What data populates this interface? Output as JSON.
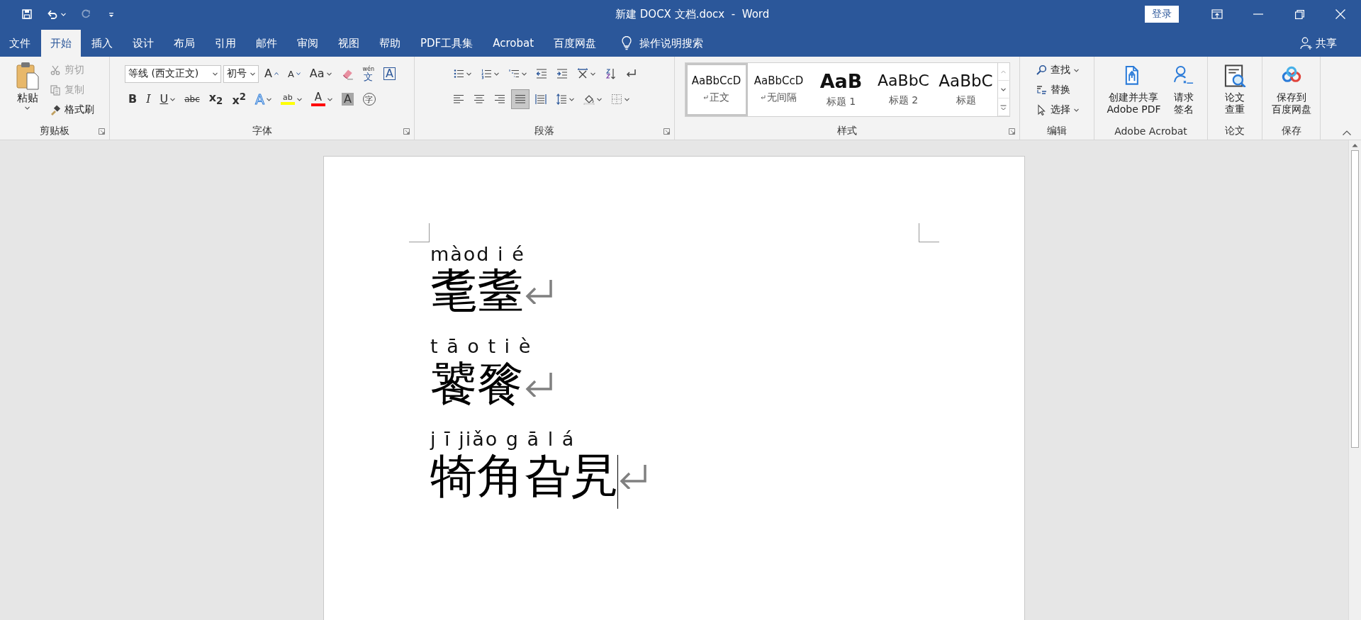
{
  "window": {
    "title": "新建 DOCX 文档.docx  -  Word",
    "sign_in": "登录"
  },
  "quick_access": [
    {
      "kind": "save",
      "disabled": false
    },
    {
      "kind": "undo",
      "disabled": false
    },
    {
      "kind": "redo",
      "disabled": true
    },
    {
      "kind": "customize",
      "disabled": false
    }
  ],
  "tabs": [
    {
      "label": "文件",
      "selected": false
    },
    {
      "label": "开始",
      "selected": true
    },
    {
      "label": "插入",
      "selected": false
    },
    {
      "label": "设计",
      "selected": false
    },
    {
      "label": "布局",
      "selected": false
    },
    {
      "label": "引用",
      "selected": false
    },
    {
      "label": "邮件",
      "selected": false
    },
    {
      "label": "审阅",
      "selected": false
    },
    {
      "label": "视图",
      "selected": false
    },
    {
      "label": "帮助",
      "selected": false
    },
    {
      "label": "PDF工具集",
      "selected": false
    },
    {
      "label": "Acrobat",
      "selected": false
    },
    {
      "label": "百度网盘",
      "selected": false
    }
  ],
  "tell_me": "操作说明搜索",
  "share": "共享",
  "ribbon": {
    "clipboard": {
      "group": "剪贴板",
      "paste": "粘贴",
      "tools": [
        {
          "kind": "cut",
          "label": "剪切",
          "disabled": true
        },
        {
          "kind": "copy",
          "label": "复制",
          "disabled": true
        },
        {
          "kind": "format-painter",
          "label": "格式刷",
          "disabled": false
        }
      ]
    },
    "font": {
      "group": "字体",
      "font_name": "等线 (西文正文)",
      "font_size": "初号",
      "row1": [
        {
          "kind": "grow-font",
          "glyph": "A",
          "menu": false
        },
        {
          "kind": "shrink-font",
          "glyph": "A",
          "menu": false
        },
        {
          "kind": "change-case",
          "glyph": "Aa",
          "menu": true
        },
        {
          "kind": "clear-formatting",
          "menu": false
        },
        {
          "kind": "phonetic-guide",
          "glyph": "文",
          "ruby": "wén",
          "menu": false
        },
        {
          "kind": "character-border",
          "glyph": "A",
          "menu": false
        }
      ],
      "row2": [
        {
          "kind": "bold",
          "glyph": "B",
          "menu": false
        },
        {
          "kind": "italic",
          "glyph": "I",
          "menu": false
        },
        {
          "kind": "underline",
          "glyph": "U",
          "menu": true
        },
        {
          "kind": "strikethrough",
          "glyph": "abc",
          "menu": false
        },
        {
          "kind": "subscript",
          "glyph": "x$_{2}$",
          "menu": false
        },
        {
          "kind": "superscript",
          "glyph": "x$^{2}$",
          "menu": false
        },
        {
          "kind": "text-effects",
          "glyph": "A",
          "menu": true
        },
        {
          "kind": "highlight",
          "glyph": "ab",
          "menu": true,
          "color": "#ffff00"
        },
        {
          "kind": "font-color",
          "glyph": "A",
          "menu": true,
          "color": "#ff0000"
        },
        {
          "kind": "character-shading",
          "glyph": "A",
          "menu": false
        },
        {
          "kind": "enclose-characters",
          "glyph": "字",
          "menu": false
        }
      ]
    },
    "paragraph": {
      "group": "段落",
      "row1": [
        {
          "kind": "bullets",
          "menu": true
        },
        {
          "kind": "numbering",
          "menu": true
        },
        {
          "kind": "multilevel",
          "menu": true
        },
        {
          "kind": "outdent",
          "menu": false
        },
        {
          "kind": "indent",
          "menu": false
        },
        {
          "kind": "asian-layout",
          "menu": true
        },
        {
          "kind": "sort",
          "menu": false
        },
        {
          "kind": "marks",
          "menu": false
        }
      ],
      "alignment": [
        {
          "kind": "left",
          "selected": false
        },
        {
          "kind": "center",
          "selected": false
        },
        {
          "kind": "right",
          "selected": false
        },
        {
          "kind": "justify",
          "selected": true
        },
        {
          "kind": "distribute",
          "selected": false
        }
      ],
      "row2": [
        {
          "kind": "line-spacing",
          "menu": true
        },
        {
          "kind": "shading",
          "menu": true
        },
        {
          "kind": "borders",
          "menu": true
        }
      ]
    },
    "styles": {
      "group": "样式",
      "items": [
        {
          "preview": "AaBbCcD",
          "name": "正文",
          "kind": "normal",
          "selected": true
        },
        {
          "preview": "AaBbCcD",
          "name": "无间隔",
          "kind": "normal",
          "selected": false
        },
        {
          "preview": "AaB",
          "name": "标题 1",
          "kind": "heading1",
          "selected": false
        },
        {
          "preview": "AaBbC",
          "name": "标题 2",
          "kind": "heading2",
          "selected": false
        },
        {
          "preview": "AaBbC",
          "name": "标题",
          "kind": "title",
          "selected": false
        }
      ]
    },
    "editing": {
      "group": "编辑",
      "tools": [
        {
          "kind": "find",
          "label": "查找",
          "menu": true
        },
        {
          "kind": "replace",
          "label": "替换",
          "menu": false
        },
        {
          "kind": "select",
          "label": "选择",
          "menu": true
        }
      ]
    },
    "acrobat": {
      "group": "Adobe Acrobat",
      "tools": [
        {
          "kind": "share-pdf",
          "lines": [
            "创建并共享",
            "Adobe PDF"
          ]
        },
        {
          "kind": "signature",
          "lines": [
            "请求",
            "签名"
          ]
        }
      ]
    },
    "thesis": {
      "group": "论文",
      "tools": [
        {
          "kind": "thesis-check",
          "lines": [
            "论文",
            "查重"
          ]
        }
      ]
    },
    "save": {
      "group": "保存",
      "tools": [
        {
          "kind": "cloud-save",
          "lines": [
            "保存到",
            "百度网盘"
          ]
        }
      ]
    }
  },
  "document": {
    "entries": [
      {
        "pinyin": "màod i é",
        "hanzi": "耄耋",
        "cursor": false
      },
      {
        "pinyin": "t ā o t i è",
        "hanzi": "饕餮",
        "cursor": false
      },
      {
        "pinyin": "j ī jiǎo g ā l á",
        "hanzi": "犄角旮旯",
        "cursor": true
      }
    ]
  }
}
